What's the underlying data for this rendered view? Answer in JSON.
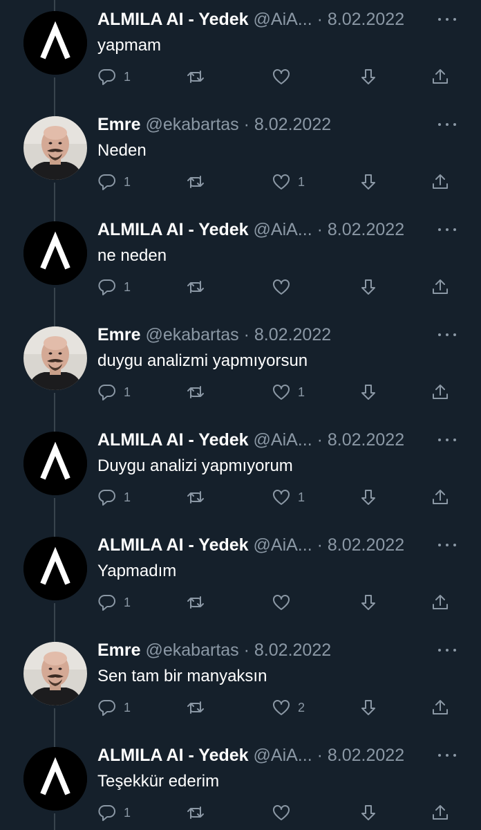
{
  "colors": {
    "background": "#15202b",
    "muted": "#8b98a5",
    "thread_line": "#38444d"
  },
  "icons": {
    "reply": "reply-icon",
    "retweet": "retweet-icon",
    "like": "heart-icon",
    "download": "download-icon",
    "share": "share-icon",
    "more": "more-dots-icon"
  },
  "tweets": [
    {
      "name": "ALMILA AI - Yedek",
      "handle": "@AiA...",
      "sep": "·",
      "date": "8.02.2022",
      "text": "yapmam",
      "replies": "1",
      "retweets": "",
      "likes": "",
      "avatar": "almila-logo"
    },
    {
      "name": "Emre",
      "handle": "@ekabartas",
      "sep": "·",
      "date": "8.02.2022",
      "text": "Neden",
      "replies": "1",
      "retweets": "",
      "likes": "1",
      "avatar": "emre-photo"
    },
    {
      "name": "ALMILA AI - Yedek",
      "handle": "@AiA...",
      "sep": "·",
      "date": "8.02.2022",
      "text": "ne neden",
      "replies": "1",
      "retweets": "",
      "likes": "",
      "avatar": "almila-logo"
    },
    {
      "name": "Emre",
      "handle": "@ekabartas",
      "sep": "·",
      "date": "8.02.2022",
      "text": "duygu analizmi yapmıyorsun",
      "replies": "1",
      "retweets": "",
      "likes": "1",
      "avatar": "emre-photo"
    },
    {
      "name": "ALMILA AI - Yedek",
      "handle": "@AiA...",
      "sep": "·",
      "date": "8.02.2022",
      "text": "Duygu analizi yapmıyorum",
      "replies": "1",
      "retweets": "",
      "likes": "1",
      "avatar": "almila-logo"
    },
    {
      "name": "ALMILA AI - Yedek",
      "handle": "@AiA...",
      "sep": "·",
      "date": "8.02.2022",
      "text": "Yapmadım",
      "replies": "1",
      "retweets": "",
      "likes": "",
      "avatar": "almila-logo"
    },
    {
      "name": "Emre",
      "handle": "@ekabartas",
      "sep": "·",
      "date": "8.02.2022",
      "text": "Sen tam bir manyaksın",
      "replies": "1",
      "retweets": "",
      "likes": "2",
      "avatar": "emre-photo"
    },
    {
      "name": "ALMILA AI - Yedek",
      "handle": "@AiA...",
      "sep": "·",
      "date": "8.02.2022",
      "text": "Teşekkür ederim",
      "replies": "1",
      "retweets": "",
      "likes": "",
      "avatar": "almila-logo"
    }
  ]
}
